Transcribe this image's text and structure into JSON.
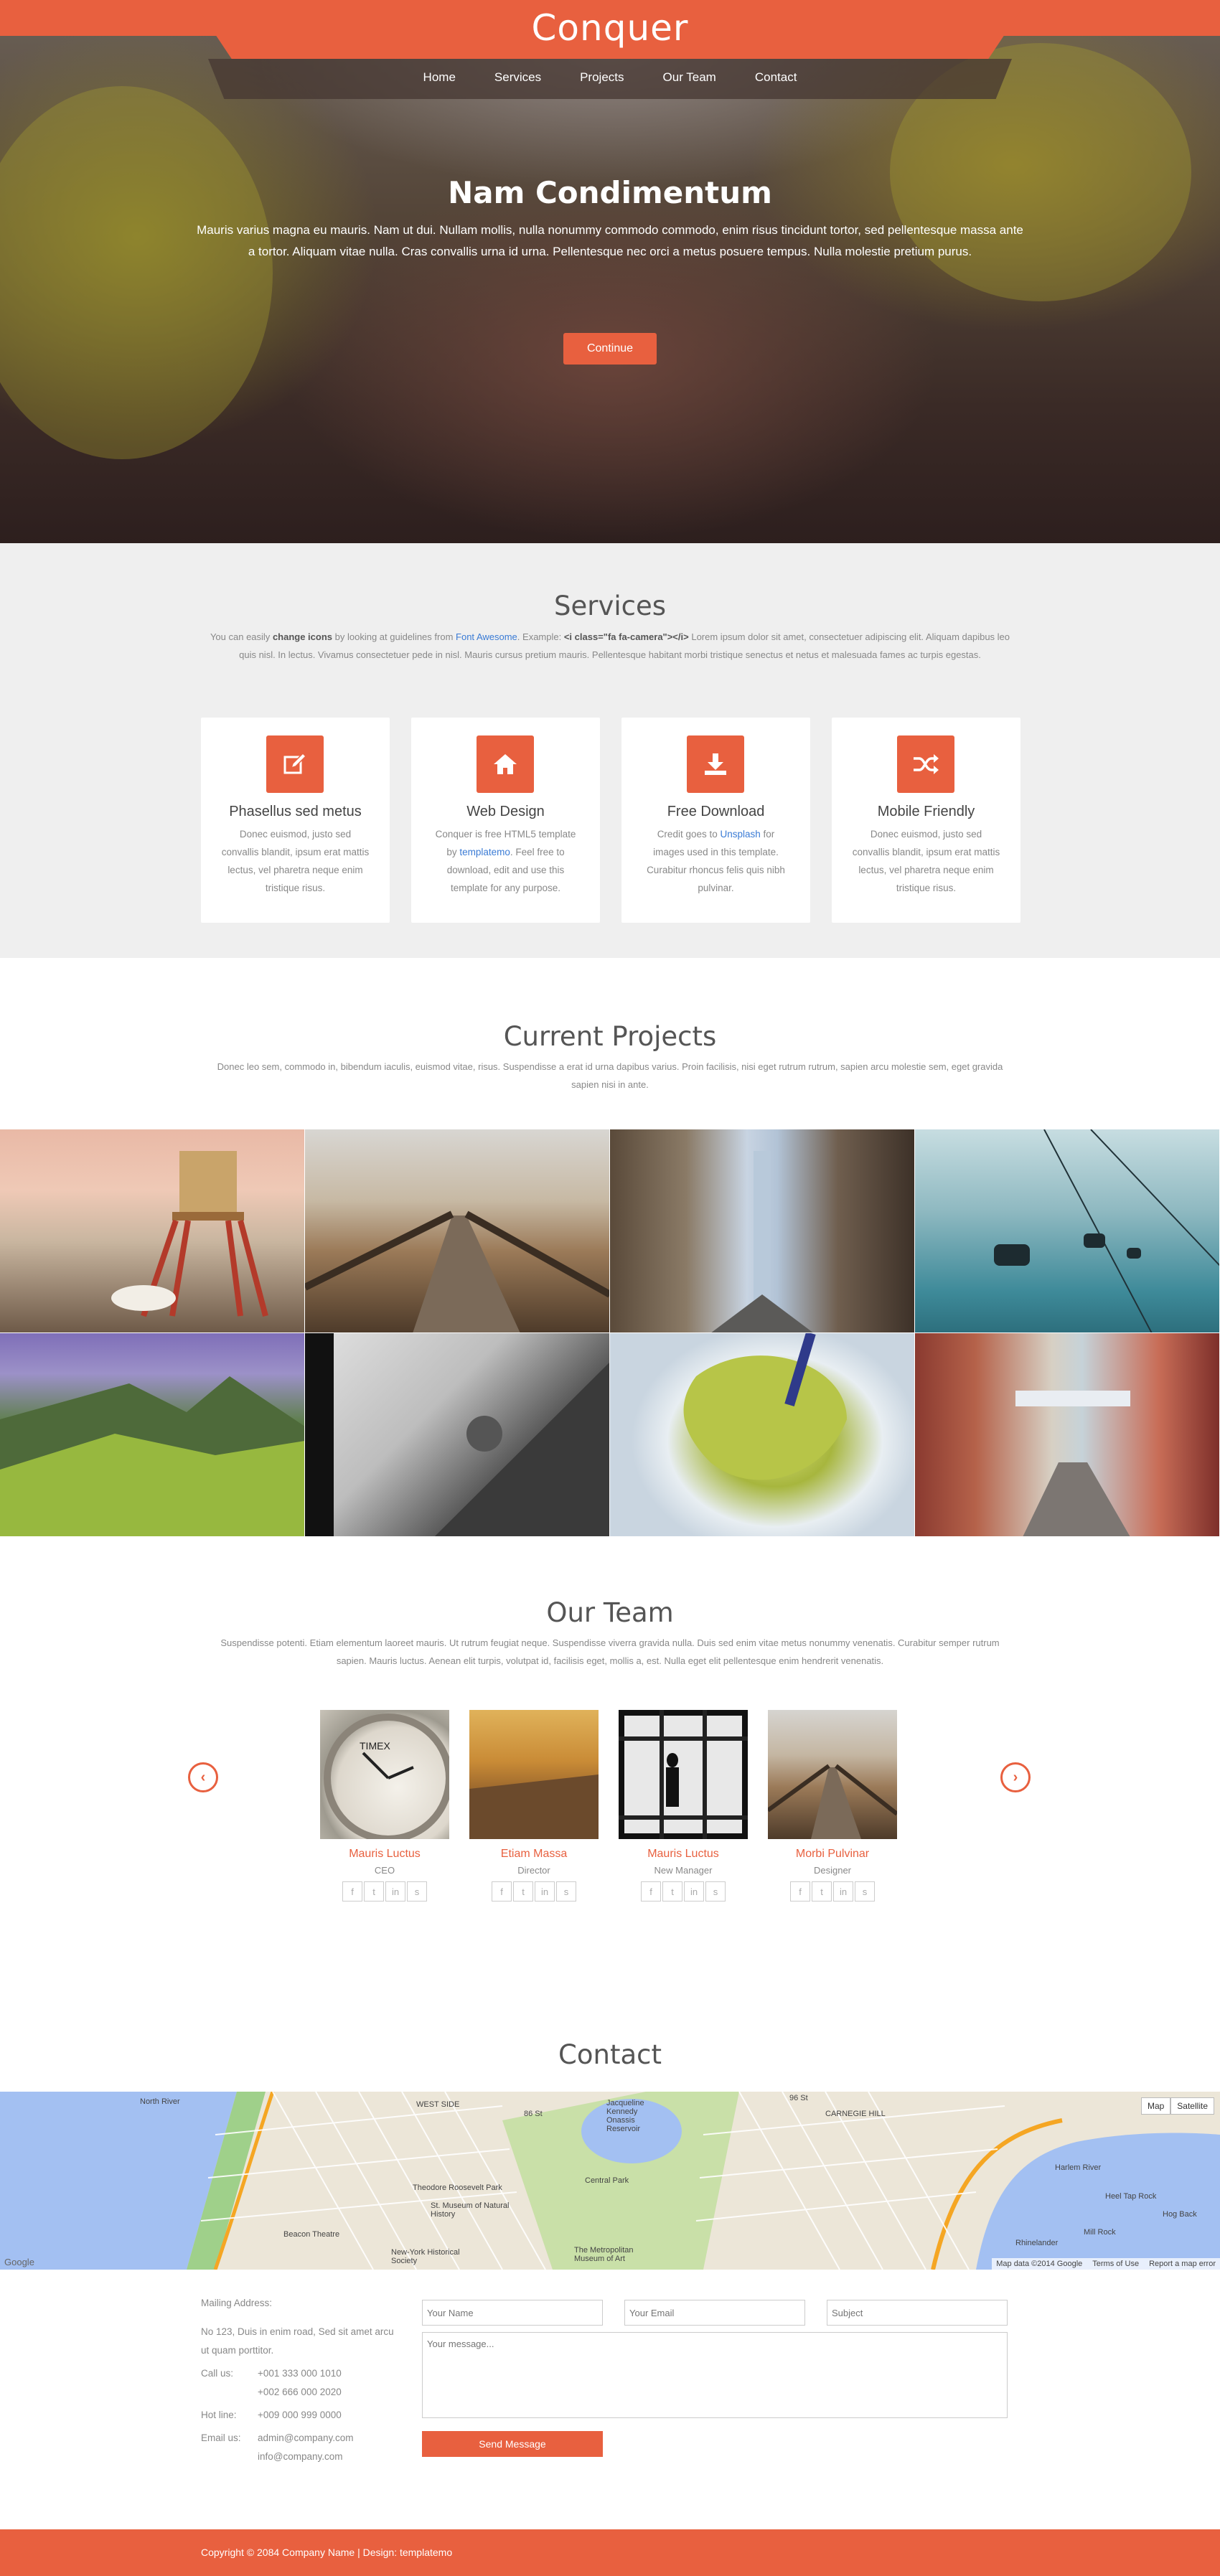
{
  "header": {
    "brand": "Conquer",
    "nav": [
      "Home",
      "Services",
      "Projects",
      "Our Team",
      "Contact"
    ]
  },
  "hero": {
    "title": "Nam Condimentum",
    "text": "Mauris varius magna eu mauris. Nam ut dui. Nullam mollis, nulla nonummy commodo commodo, enim risus tincidunt tortor, sed pellentesque massa ante a tortor. Aliquam vitae nulla. Cras convallis urna id urna. Pellentesque nec orci a metus posuere tempus. Nulla molestie pretium purus.",
    "button": "Continue"
  },
  "services": {
    "title": "Services",
    "intro_1": "You can easily",
    "intro_bold_1": "change icons",
    "intro_2": "by looking at guidelines from",
    "intro_link": "Font Awesome",
    "intro_3": ". Example:",
    "intro_code": "<i class=\"fa fa-camera\"></i>",
    "intro_4": "Lorem ipsum dolor sit amet, consectetuer adipiscing elit. Aliquam dapibus leo quis nisl. In lectus. Vivamus consectetuer pede in nisl. Mauris cursus pretium mauris. Pellentesque habitant morbi tristique senectus et netus et malesuada fames ac turpis egestas.",
    "cards": [
      {
        "icon": "edit-icon",
        "title": "Phasellus sed metus",
        "text": "Donec euismod, justo sed convallis blandit, ipsum erat mattis lectus, vel pharetra neque enim tristique risus."
      },
      {
        "icon": "home-icon",
        "title": "Web Design",
        "text_1": "Conquer is free HTML5 template by",
        "link": "templatemo",
        "text_2": ". Feel free to download, edit and use this template for any purpose."
      },
      {
        "icon": "download-icon",
        "title": "Free Download",
        "text_1": "Credit goes to",
        "link": "Unsplash",
        "text_2": "for images used in this template. Curabitur rhoncus felis quis nibh pulvinar."
      },
      {
        "icon": "random-icon",
        "title": "Mobile Friendly",
        "text": "Donec euismod, justo sed convallis blandit, ipsum erat mattis lectus, vel pharetra neque enim tristique risus."
      }
    ]
  },
  "projects": {
    "title": "Current Projects",
    "text": "Donec leo sem, commodo in, bibendum iaculis, euismod vitae, risus. Suspendisse a erat id urna dapibus varius. Proin facilisis, nisi eget rutrum rutrum, sapien arcu molestie sem, eget gravida sapien nisi in ante."
  },
  "team": {
    "title": "Our Team",
    "text": "Suspendisse potenti. Etiam elementum laoreet mauris. Ut rutrum feugiat neque. Suspendisse viverra gravida nulla. Duis sed enim vitae metus nonummy venenatis. Curabitur semper rutrum sapien. Mauris luctus. Aenean elit turpis, volutpat id, facilisis eget, mollis a, est. Nulla eget elit pellentesque enim hendrerit venenatis.",
    "members": [
      {
        "name": "Mauris Luctus",
        "role": "CEO"
      },
      {
        "name": "Etiam Massa",
        "role": "Director"
      },
      {
        "name": "Mauris Luctus",
        "role": "New Manager"
      },
      {
        "name": "Morbi Pulvinar",
        "role": "Designer"
      }
    ],
    "social_glyphs": [
      "f",
      "t",
      "in",
      "s"
    ]
  },
  "contact": {
    "title": "Contact",
    "map": {
      "buttons": [
        "Map",
        "Satellite"
      ],
      "footer": [
        "Map data ©2014 Google",
        "Terms of Use",
        "Report a map error"
      ],
      "labels": [
        "North River",
        "Jacqueline Kennedy Onassis Reservoir",
        "Central Park",
        "Theodore Roosevelt Park",
        "St. Museum of Natural History",
        "Beacon Theatre",
        "New-York Historical Society",
        "The Metropolitan Museum of Art",
        "Harlem River",
        "Heel Tap Rock",
        "Hog Back",
        "Mill Rock",
        "Rhinelander",
        "WEST SIDE",
        "CARNEGIE HILL",
        "86 St",
        "96 St",
        "Google"
      ]
    },
    "address_heading": "Mailing Address:",
    "address": "No 123, Duis in enim road, Sed sit amet arcu ut quam porttitor.",
    "call_label": "Call us:",
    "call": [
      "+001 333 000 1010",
      "+002 666 000 2020"
    ],
    "hotline_label": "Hot line:",
    "hotline": "+009 000 999 0000",
    "email_label": "Email us:",
    "emails": [
      "admin@company.com",
      "info@company.com"
    ],
    "form": {
      "name_placeholder": "Your Name",
      "email_placeholder": "Your Email",
      "subject_placeholder": "Subject",
      "message_placeholder": "Your message...",
      "send": "Send Message"
    }
  },
  "footer": {
    "text": "Copyright © 2084 Company Name | Design: templatemo"
  },
  "colors": {
    "accent": "#e8603f",
    "link": "#3a7bd5",
    "services_bg": "#efefef"
  }
}
